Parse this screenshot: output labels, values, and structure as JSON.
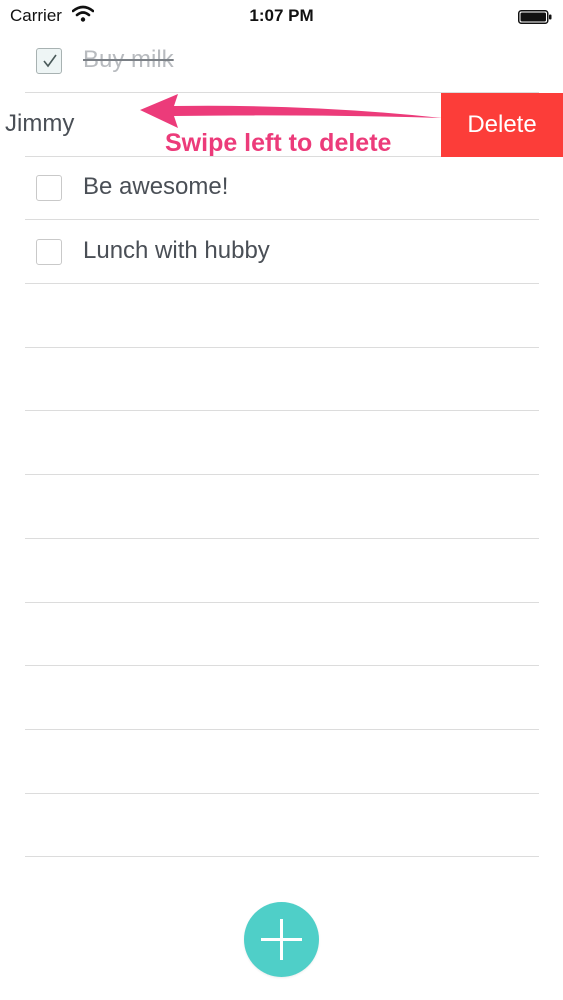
{
  "status_bar": {
    "carrier": "Carrier",
    "time": "1:07 PM"
  },
  "todos": [
    {
      "label": "Buy milk",
      "checked": true
    },
    {
      "label": "Call Jimmy",
      "checked": false,
      "swiped": true
    },
    {
      "label": "Be awesome!",
      "checked": false
    },
    {
      "label": "Lunch with hubby",
      "checked": false
    }
  ],
  "swipe_visible_text": "l Jimmy",
  "delete_label": "Delete",
  "hint_text": "Swipe left to delete",
  "colors": {
    "delete": "#fc3d39",
    "accent": "#4fcfc8",
    "hint": "#ec3b7a",
    "divider": "#dcdcdc"
  },
  "icons": [
    "wifi-icon",
    "battery-icon",
    "check-icon",
    "arrow-left-icon",
    "plus-icon"
  ]
}
